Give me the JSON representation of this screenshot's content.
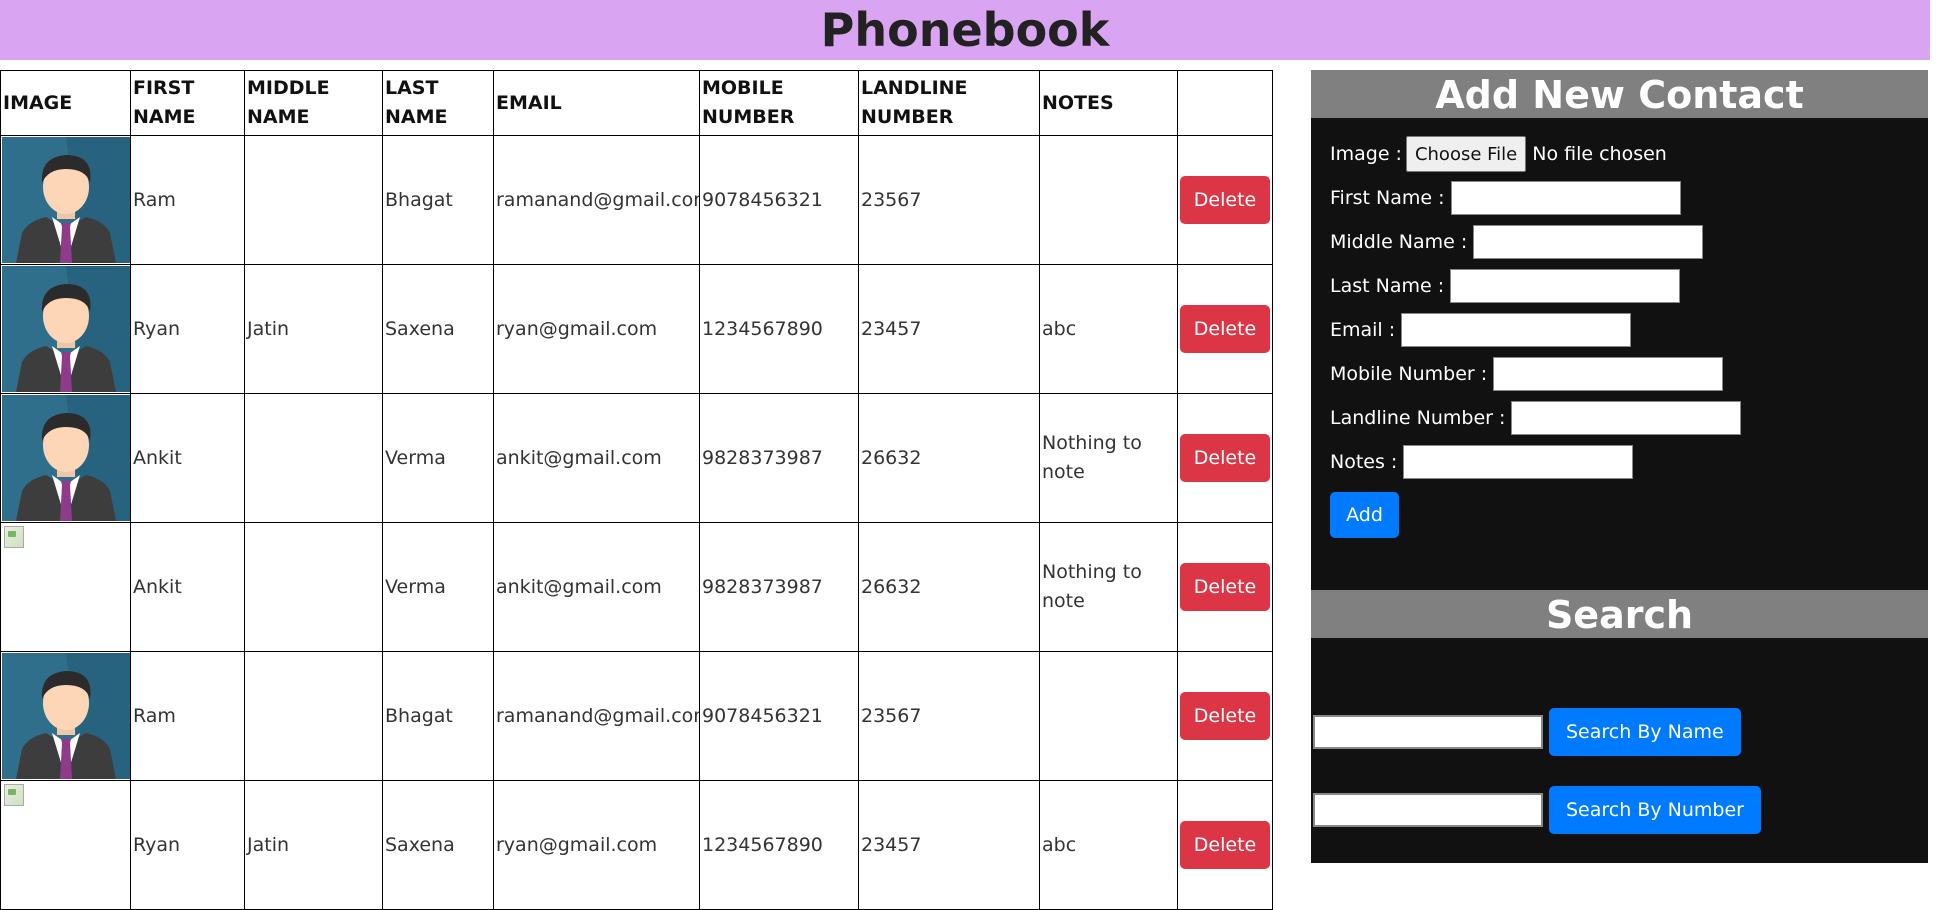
{
  "header": {
    "title": "Phonebook"
  },
  "table": {
    "columns": [
      "IMAGE",
      "FIRST NAME",
      "MIDDLE NAME",
      "LAST NAME",
      "EMAIL",
      "MOBILE NUMBER",
      "LANDLINE NUMBER",
      "NOTES",
      ""
    ],
    "delete_label": "Delete",
    "rows": [
      {
        "has_image": true,
        "first": "Ram",
        "middle": "",
        "last": "Bhagat",
        "email": "ramanand@gmail.com",
        "mobile": "9078456321",
        "landline": "23567",
        "notes": ""
      },
      {
        "has_image": true,
        "first": "Ryan",
        "middle": "Jatin",
        "last": "Saxena",
        "email": "ryan@gmail.com",
        "mobile": "1234567890",
        "landline": "23457",
        "notes": "abc"
      },
      {
        "has_image": true,
        "first": "Ankit",
        "middle": "",
        "last": "Verma",
        "email": "ankit@gmail.com",
        "mobile": "9828373987",
        "landline": "26632",
        "notes": "Nothing to note"
      },
      {
        "has_image": false,
        "first": "Ankit",
        "middle": "",
        "last": "Verma",
        "email": "ankit@gmail.com",
        "mobile": "9828373987",
        "landline": "26632",
        "notes": "Nothing to note"
      },
      {
        "has_image": true,
        "first": "Ram",
        "middle": "",
        "last": "Bhagat",
        "email": "ramanand@gmail.com",
        "mobile": "9078456321",
        "landline": "23567",
        "notes": ""
      },
      {
        "has_image": false,
        "first": "Ryan",
        "middle": "Jatin",
        "last": "Saxena",
        "email": "ryan@gmail.com",
        "mobile": "1234567890",
        "landline": "23457",
        "notes": "abc"
      }
    ]
  },
  "add_contact": {
    "title": "Add New Contact",
    "image_label": "Image :",
    "choose_file_label": "Choose File",
    "no_file_text": "No file chosen",
    "first_name_label": "First Name :",
    "middle_name_label": "Middle Name :",
    "last_name_label": "Last Name :",
    "email_label": "Email :",
    "mobile_label": "Mobile Number :",
    "landline_label": "Landline Number :",
    "notes_label": "Notes :",
    "add_button": "Add"
  },
  "search": {
    "title": "Search",
    "by_name_button": "Search By Name",
    "by_number_button": "Search By Number",
    "name_query": "",
    "number_query": ""
  },
  "colors": {
    "header_bg": "#d9a4f2",
    "panel_bg": "#111111",
    "panel_title_bg": "#808080",
    "delete": "#dc3545",
    "primary": "#007bff"
  }
}
